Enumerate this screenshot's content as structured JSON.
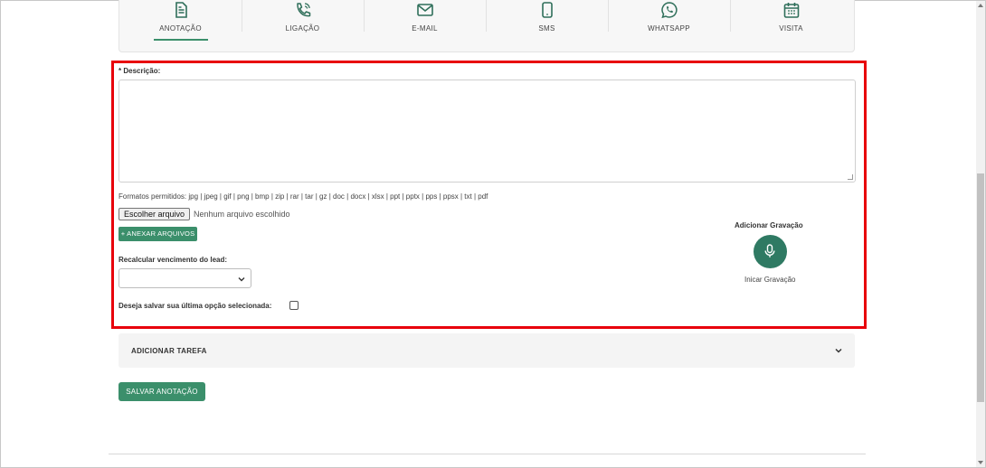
{
  "tabs": [
    {
      "label": "ANOTAÇÃO",
      "icon": "document-icon",
      "active": true
    },
    {
      "label": "LIGAÇÃO",
      "icon": "phone-call-icon",
      "active": false
    },
    {
      "label": "E-MAIL",
      "icon": "envelope-icon",
      "active": false
    },
    {
      "label": "SMS",
      "icon": "mobile-phone-icon",
      "active": false
    },
    {
      "label": "WHATSAPP",
      "icon": "whatsapp-icon",
      "active": false
    },
    {
      "label": "VISITA",
      "icon": "calendar-icon",
      "active": false
    }
  ],
  "form": {
    "description_label": "* Descrição:",
    "description_value": "",
    "formats_text": "Formatos permitidos: jpg | jpeg | gif | png | bmp | zip | rar | tar | gz | doc | docx | xlsx | ppt | pptx | pps | ppsx | txt | pdf",
    "file_button_label": "Escolher arquivo",
    "file_status": "Nenhum arquivo escolhido",
    "attach_button_label": "+ ANEXAR ARQUIVOS",
    "recalc_label": "Recalcular vencimento do lead:",
    "recalc_value": "",
    "save_option_label": "Deseja salvar sua última opção selecionada:",
    "save_option_checked": false
  },
  "recording": {
    "title": "Adicionar Gravação",
    "button_icon": "microphone-icon",
    "caption": "Inicar Gravação"
  },
  "task": {
    "label": "ADICIONAR TAREFA"
  },
  "actions": {
    "save_note_label": "SALVAR ANOTAÇÃO"
  },
  "colors": {
    "accent": "#3b8f6b",
    "record_button": "#2f7a63",
    "highlight": "#e8000b"
  }
}
